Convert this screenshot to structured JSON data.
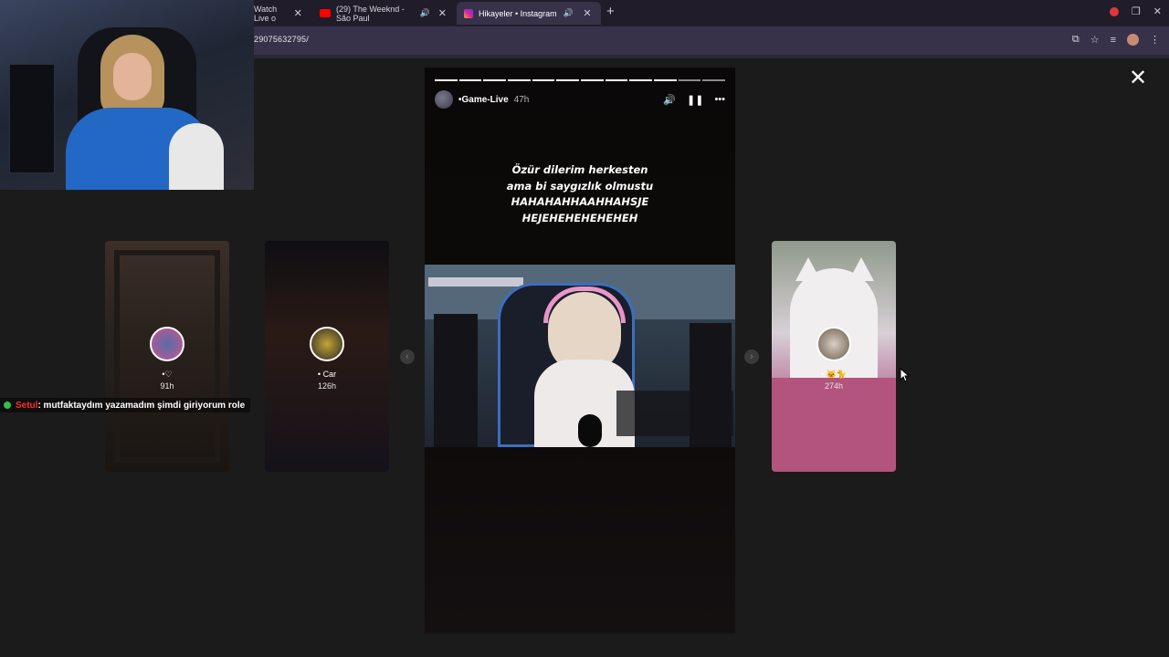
{
  "browser": {
    "tabs": [
      {
        "title": "Watch Live o",
        "favicon_color": "#9146ff",
        "active": false
      },
      {
        "title": "(29) The Weeknd - São Paul",
        "favicon_color": "#ff0000",
        "active": false,
        "audio": "🔊"
      },
      {
        "title": "Hikayeler • Instagram",
        "favicon_color": "#d6249f",
        "active": true,
        "audio": "🔊"
      }
    ],
    "close_glyph": "✕",
    "new_tab_glyph": "+",
    "url": "29075632795/"
  },
  "viewer": {
    "close_label": "✕",
    "prev_label": "‹",
    "next_label": "›"
  },
  "story": {
    "username": "•Game-Live",
    "time": "47h",
    "caption_lines": [
      "Özür dilerim herkesten",
      "ama bi saygızlık olmustu",
      "HAHAHAHHAAHHAHSJE",
      "HEJEHEHEHEHEHEH"
    ],
    "controls": {
      "volume": "🔊",
      "pause": "❚❚",
      "more": "•••"
    },
    "progress_segments": 12,
    "progress_done": 10
  },
  "cards": [
    {
      "name": "•♡",
      "time": "91h"
    },
    {
      "name": "• Car",
      "time": "126h"
    },
    {
      "name": "• 🐱🐈",
      "time": "274h"
    }
  ],
  "chat": {
    "user": "Setul",
    "message": " : mutfaktaydım yazamadım şimdi giriyorum role"
  }
}
